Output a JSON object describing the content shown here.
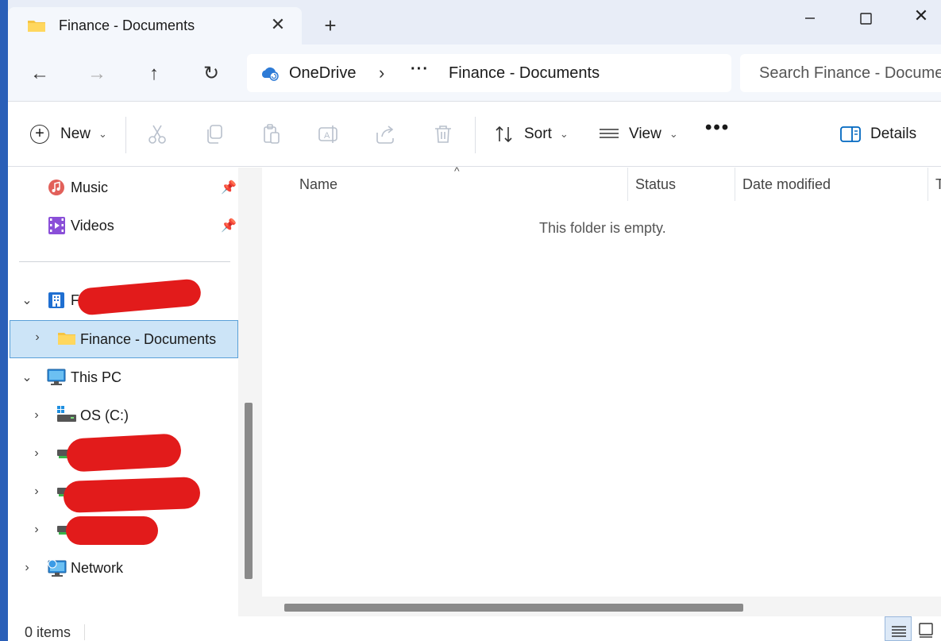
{
  "titlebar": {
    "tab_title": "Finance - Documents",
    "tab_close": "✕",
    "new_tab": "+",
    "minimize": "—",
    "close": "✕"
  },
  "address": {
    "back": "←",
    "forward": "→",
    "up": "↑",
    "refresh": "↻",
    "root": "OneDrive",
    "separator": "›",
    "more": "···",
    "current": "Finance - Documents",
    "search_placeholder": "Search Finance - Documents"
  },
  "commands": {
    "new_label": "New",
    "sort_label": "Sort",
    "view_label": "View",
    "more": "•••",
    "details_label": "Details"
  },
  "sidebar": {
    "quick_access": [
      {
        "label": "Music",
        "icon": "music-icon",
        "pinned": true
      },
      {
        "label": "Videos",
        "icon": "videos-icon",
        "pinned": true
      }
    ],
    "org_initial": "F",
    "selected_folder": "Finance - Documents",
    "this_pc": "This PC",
    "os_drive": "OS (C:)",
    "network": "Network"
  },
  "columns": {
    "name": "Name",
    "status": "Status",
    "date_modified": "Date modified",
    "type_partial": "T"
  },
  "main": {
    "empty_message": "This folder is empty."
  },
  "status": {
    "item_count": "0 items"
  },
  "colors": {
    "accent": "#0067c0",
    "selection_bg": "#cce4f7",
    "selection_border": "#5aa0d8",
    "redaction": "#e21b1b"
  }
}
